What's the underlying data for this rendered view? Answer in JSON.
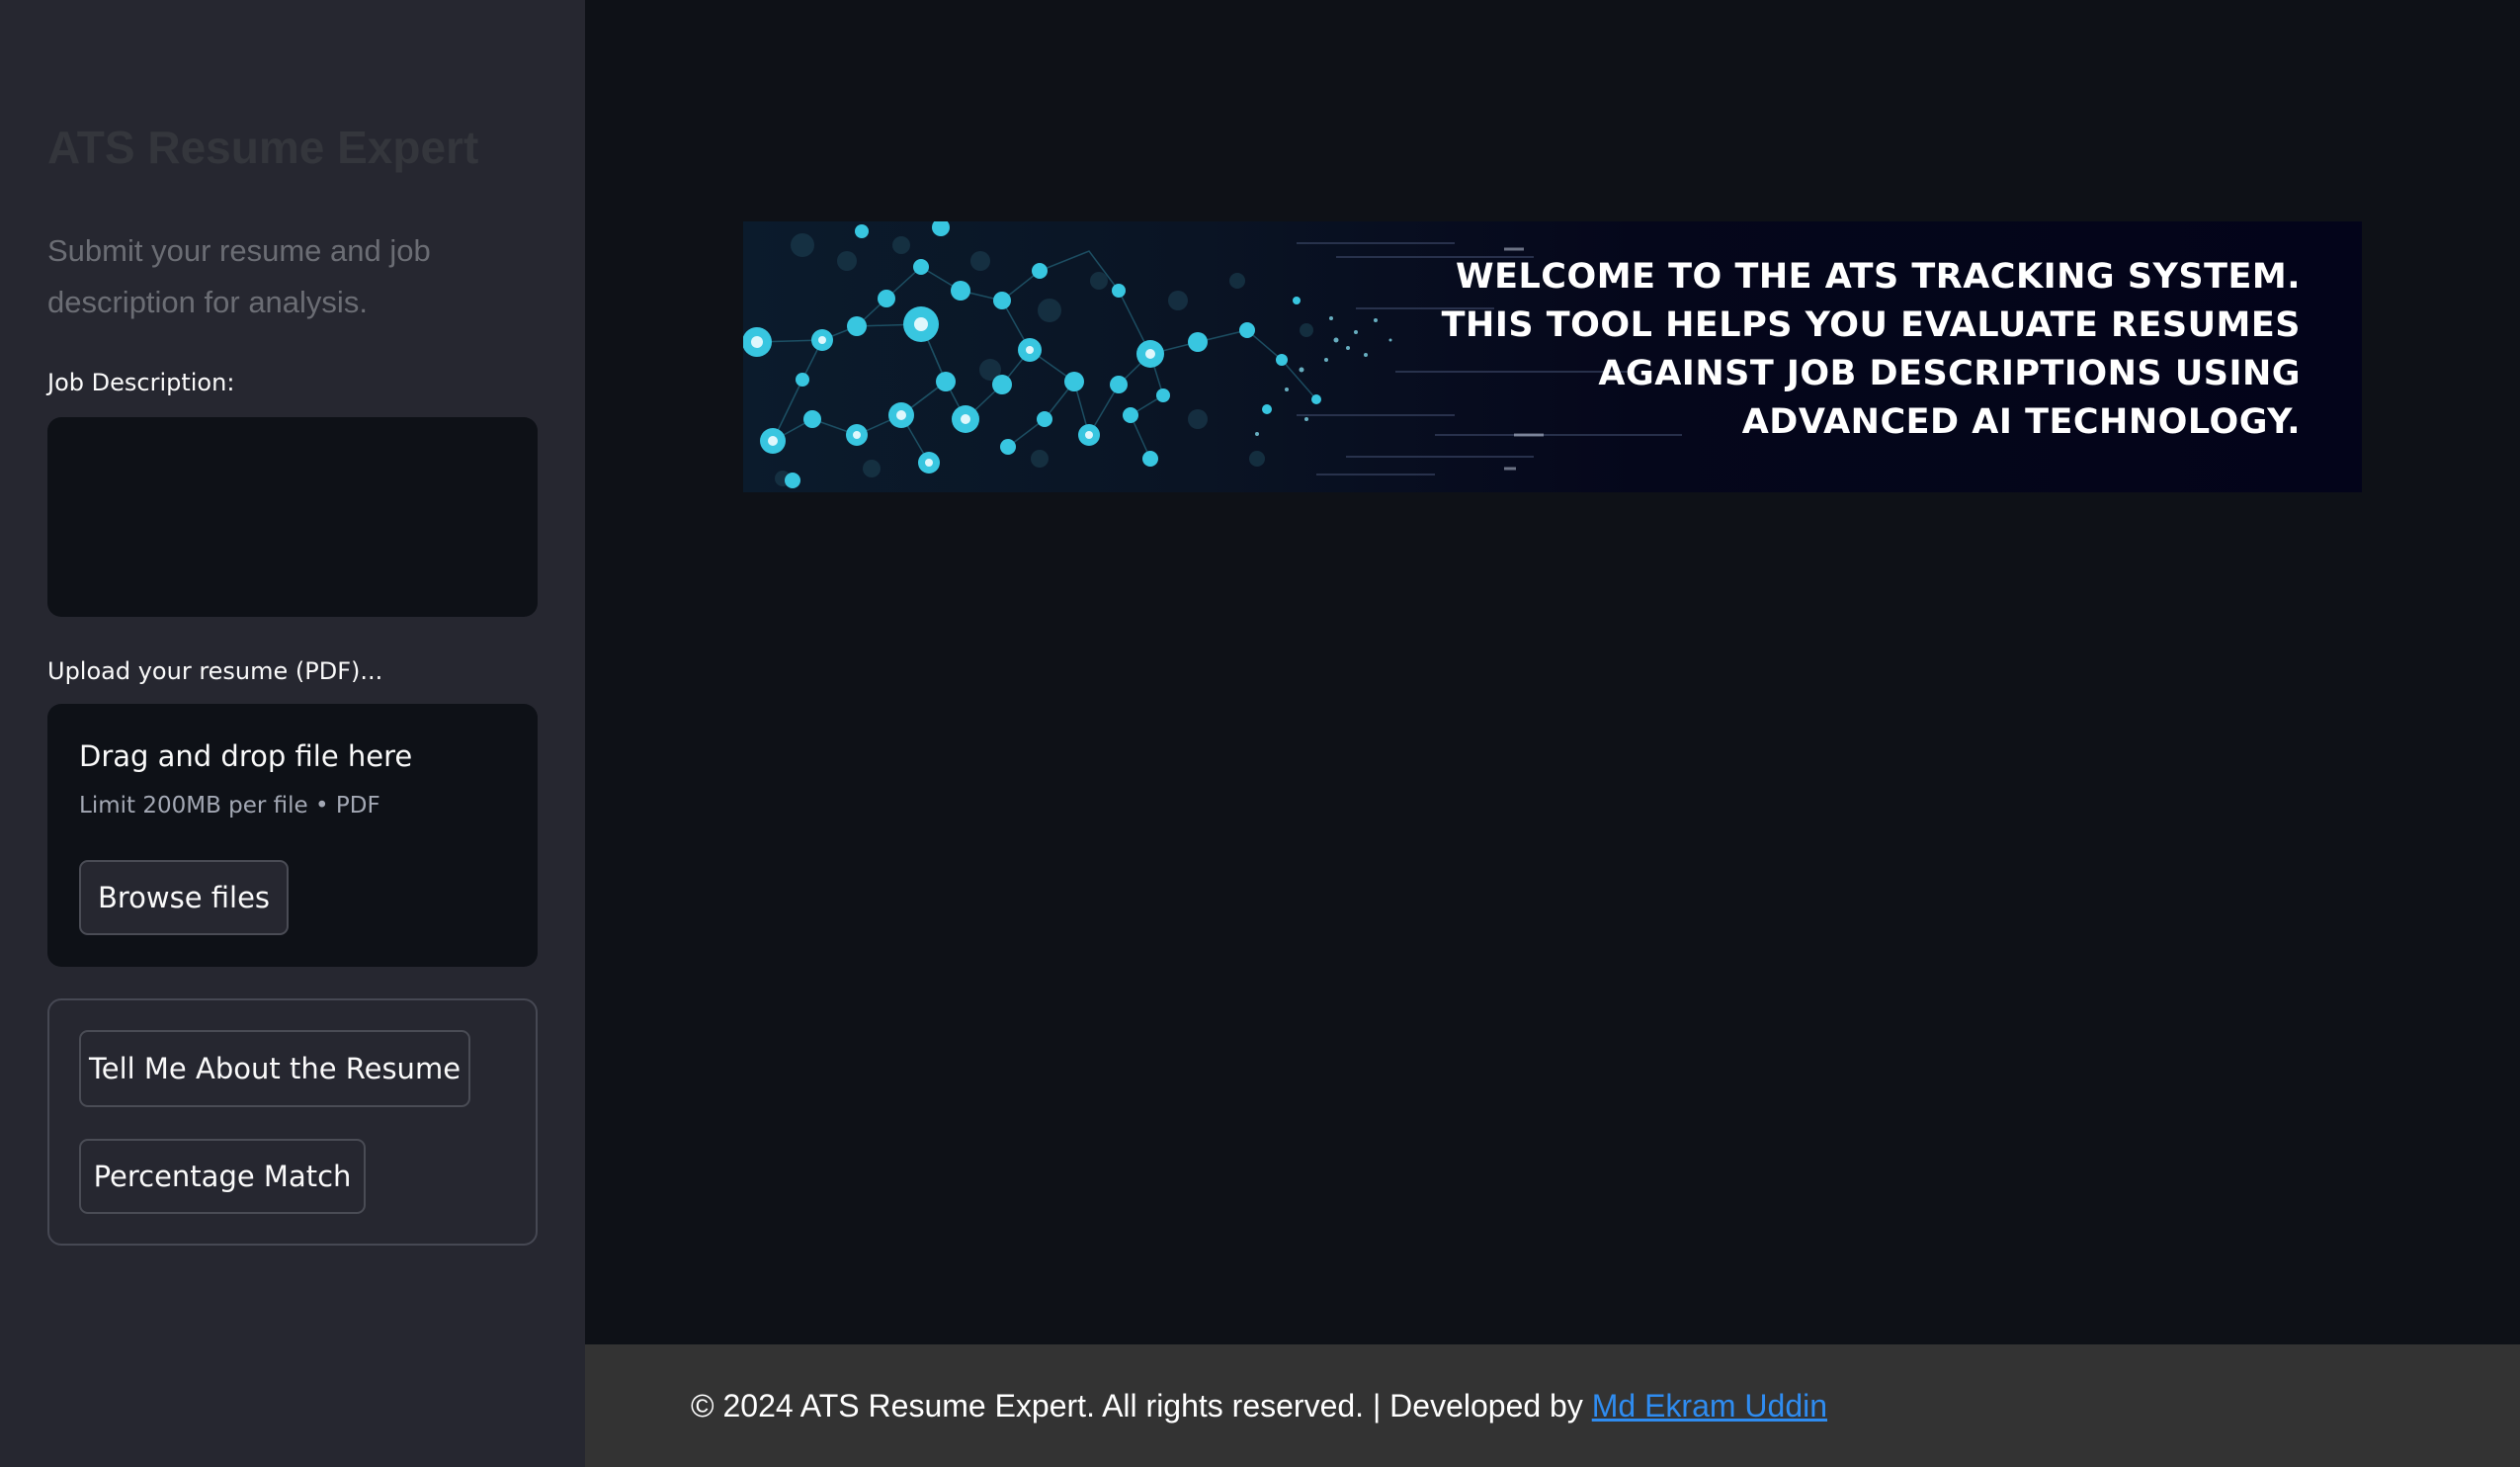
{
  "sidebar": {
    "title": "ATS Resume Expert",
    "subtitle": "Submit your resume and job description for analysis.",
    "job_description": {
      "label": "Job Description:",
      "value": ""
    },
    "uploader": {
      "label": "Upload your resume (PDF)...",
      "drop_text": "Drag and drop file here",
      "limit_text": "Limit 200MB per file • PDF",
      "browse_label": "Browse files"
    },
    "actions": {
      "tell_label": "Tell Me About the Resume",
      "match_label": "Percentage Match"
    }
  },
  "banner": {
    "lines": [
      "WELCOME TO THE ATS TRACKING SYSTEM.",
      "THIS TOOL HELPS YOU EVALUATE RESUMES",
      "AGAINST JOB DESCRIPTIONS USING",
      "ADVANCED AI TECHNOLOGY."
    ]
  },
  "footer": {
    "text": "© 2024 ATS Resume Expert. All rights reserved. | Developed by",
    "link_text": "Md Ekram Uddin"
  },
  "colors": {
    "sidebar_bg": "#262730",
    "main_bg": "#0e1117",
    "footer_bg": "#333333",
    "link": "#2f8cf0",
    "node_cyan": "#38c6e0"
  }
}
